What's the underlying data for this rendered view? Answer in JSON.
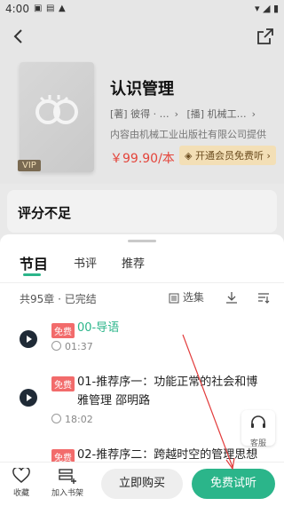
{
  "status_bar": {
    "time": "4:00"
  },
  "book": {
    "title": "认识管理",
    "author": "[著] 彼得 · …",
    "narrator": "[播] 机械工…",
    "publisher": "内容由机械工业出版社有限公司提供",
    "price": "￥99.90/本",
    "vip_badge": "VIP",
    "vip_free": "开通会员免费听"
  },
  "rating": {
    "title": "评分不足"
  },
  "tabs": [
    {
      "label": "节目",
      "active": true
    },
    {
      "label": "书评",
      "active": false
    },
    {
      "label": "推荐",
      "active": false
    }
  ],
  "chapter_summary": "共95章 · 已完结",
  "tools": {
    "select_label": "选集"
  },
  "chapters": [
    {
      "tag": "免费",
      "title": "00-导语",
      "duration": "01:37",
      "playing": true
    },
    {
      "tag": "免费",
      "title": "01-推荐序一：功能正常的社会和博雅管理 邵明路",
      "duration": "18:02",
      "playing": false
    },
    {
      "tag": "免费",
      "title": "02-推荐序二：跨越时空的管理思想",
      "duration": "",
      "playing": false
    }
  ],
  "service": {
    "label": "客服"
  },
  "bottom_bar": {
    "favorite": "收藏",
    "add_shelf": "加入书架",
    "buy": "立即购买",
    "listen": "免费试听"
  },
  "colors": {
    "accent": "#2bb58a",
    "price": "#e4443a",
    "free_tag": "#f26b6b"
  }
}
